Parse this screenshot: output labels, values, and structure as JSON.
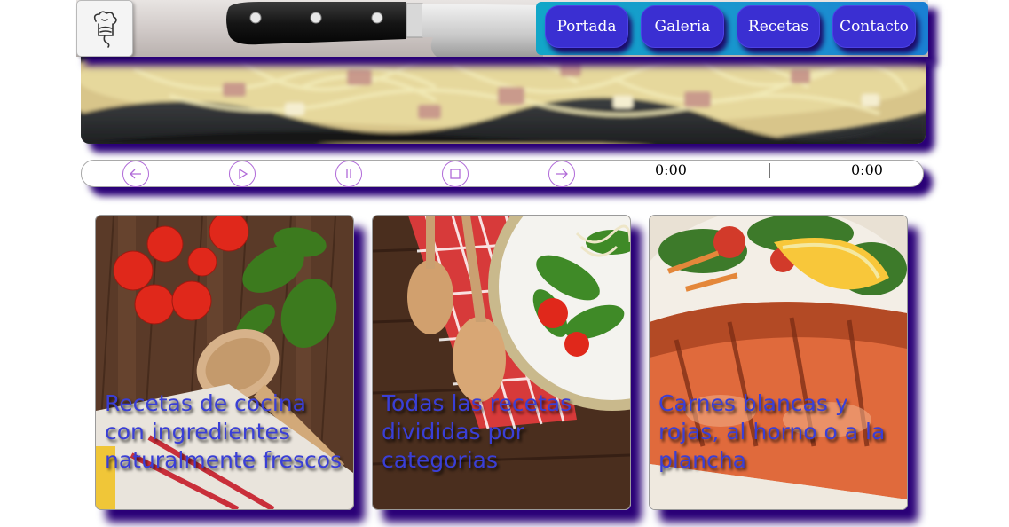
{
  "header": {
    "logo_icon": "chef-hat-icon",
    "nav": [
      {
        "label": "Portada"
      },
      {
        "label": "Galeria"
      },
      {
        "label": "Recetas"
      },
      {
        "label": "Contacto"
      }
    ]
  },
  "player": {
    "current_time": "0:00",
    "separator": "|",
    "duration": "0:00",
    "controls": [
      "arrow-left-icon",
      "play-icon",
      "pause-icon",
      "stop-icon",
      "arrow-right-icon"
    ]
  },
  "cards": [
    {
      "caption": "Recetas de cocina con ingredientes naturalmente frescos"
    },
    {
      "caption": "Todas las recetas divididas por categorias"
    },
    {
      "caption": "Carnes blancas y rojas, al horno o a la plancha"
    }
  ],
  "colors": {
    "shadow": "#2a0077",
    "nav_button": "#3a2fd2",
    "nav_bar": "#12a6c8",
    "caption_text": "#3a3fd6",
    "control_ring": "#b06ad8"
  }
}
